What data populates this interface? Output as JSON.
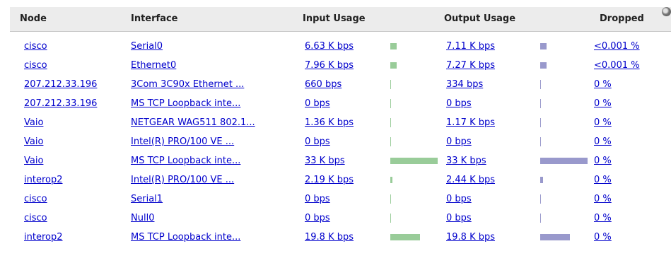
{
  "headers": {
    "node": "Node",
    "interface": "Interface",
    "input": "Input Usage",
    "output": "Output Usage",
    "dropped": "Dropped"
  },
  "colors": {
    "input_bar": "#99cc99",
    "output_bar": "#9999cc",
    "link": "#0000cc"
  },
  "rows": [
    {
      "node": "cisco",
      "interface": "Serial0",
      "input": "6.63 K bps",
      "input_fraction": 0.14,
      "output": "7.11 K bps",
      "output_fraction": 0.14,
      "dropped": "<0.001 %"
    },
    {
      "node": "cisco",
      "interface": "Ethernet0",
      "input": "7.96 K bps",
      "input_fraction": 0.14,
      "output": "7.27 K bps",
      "output_fraction": 0.14,
      "dropped": "<0.001 %"
    },
    {
      "node": "207.212.33.196",
      "interface": "3Com 3C90x Ethernet ...",
      "input": "660 bps",
      "input_fraction": 0.02,
      "output": "334 bps",
      "output_fraction": 0.01,
      "dropped": "0 %"
    },
    {
      "node": "207.212.33.196",
      "interface": "MS TCP Loopback inte...",
      "input": "0 bps",
      "input_fraction": 0.01,
      "output": "0 bps",
      "output_fraction": 0.01,
      "dropped": "0 %"
    },
    {
      "node": "Vaio",
      "interface": "NETGEAR WAG511 802.1...",
      "input": "1.36 K bps",
      "input_fraction": 0.03,
      "output": "1.17 K bps",
      "output_fraction": 0.03,
      "dropped": "0 %"
    },
    {
      "node": "Vaio",
      "interface": "Intel(R) PRO/100 VE ...",
      "input": "0 bps",
      "input_fraction": 0.01,
      "output": "0 bps",
      "output_fraction": 0.01,
      "dropped": "0 %"
    },
    {
      "node": "Vaio",
      "interface": "MS TCP Loopback inte...",
      "input": "33 K bps",
      "input_fraction": 1.0,
      "output": "33 K bps",
      "output_fraction": 1.0,
      "dropped": "0 %"
    },
    {
      "node": "interop2",
      "interface": "Intel(R) PRO/100 VE ...",
      "input": "2.19 K bps",
      "input_fraction": 0.04,
      "output": "2.44 K bps",
      "output_fraction": 0.06,
      "dropped": "0 %"
    },
    {
      "node": "cisco",
      "interface": "Serial1",
      "input": "0 bps",
      "input_fraction": 0.01,
      "output": "0 bps",
      "output_fraction": 0.01,
      "dropped": "0 %"
    },
    {
      "node": "cisco",
      "interface": "Null0",
      "input": "0 bps",
      "input_fraction": 0.01,
      "output": "0 bps",
      "output_fraction": 0.01,
      "dropped": "0 %"
    },
    {
      "node": "interop2",
      "interface": "MS TCP Loopback inte...",
      "input": "19.8 K bps",
      "input_fraction": 0.63,
      "output": "19.8 K bps",
      "output_fraction": 0.63,
      "dropped": "0 %"
    }
  ]
}
